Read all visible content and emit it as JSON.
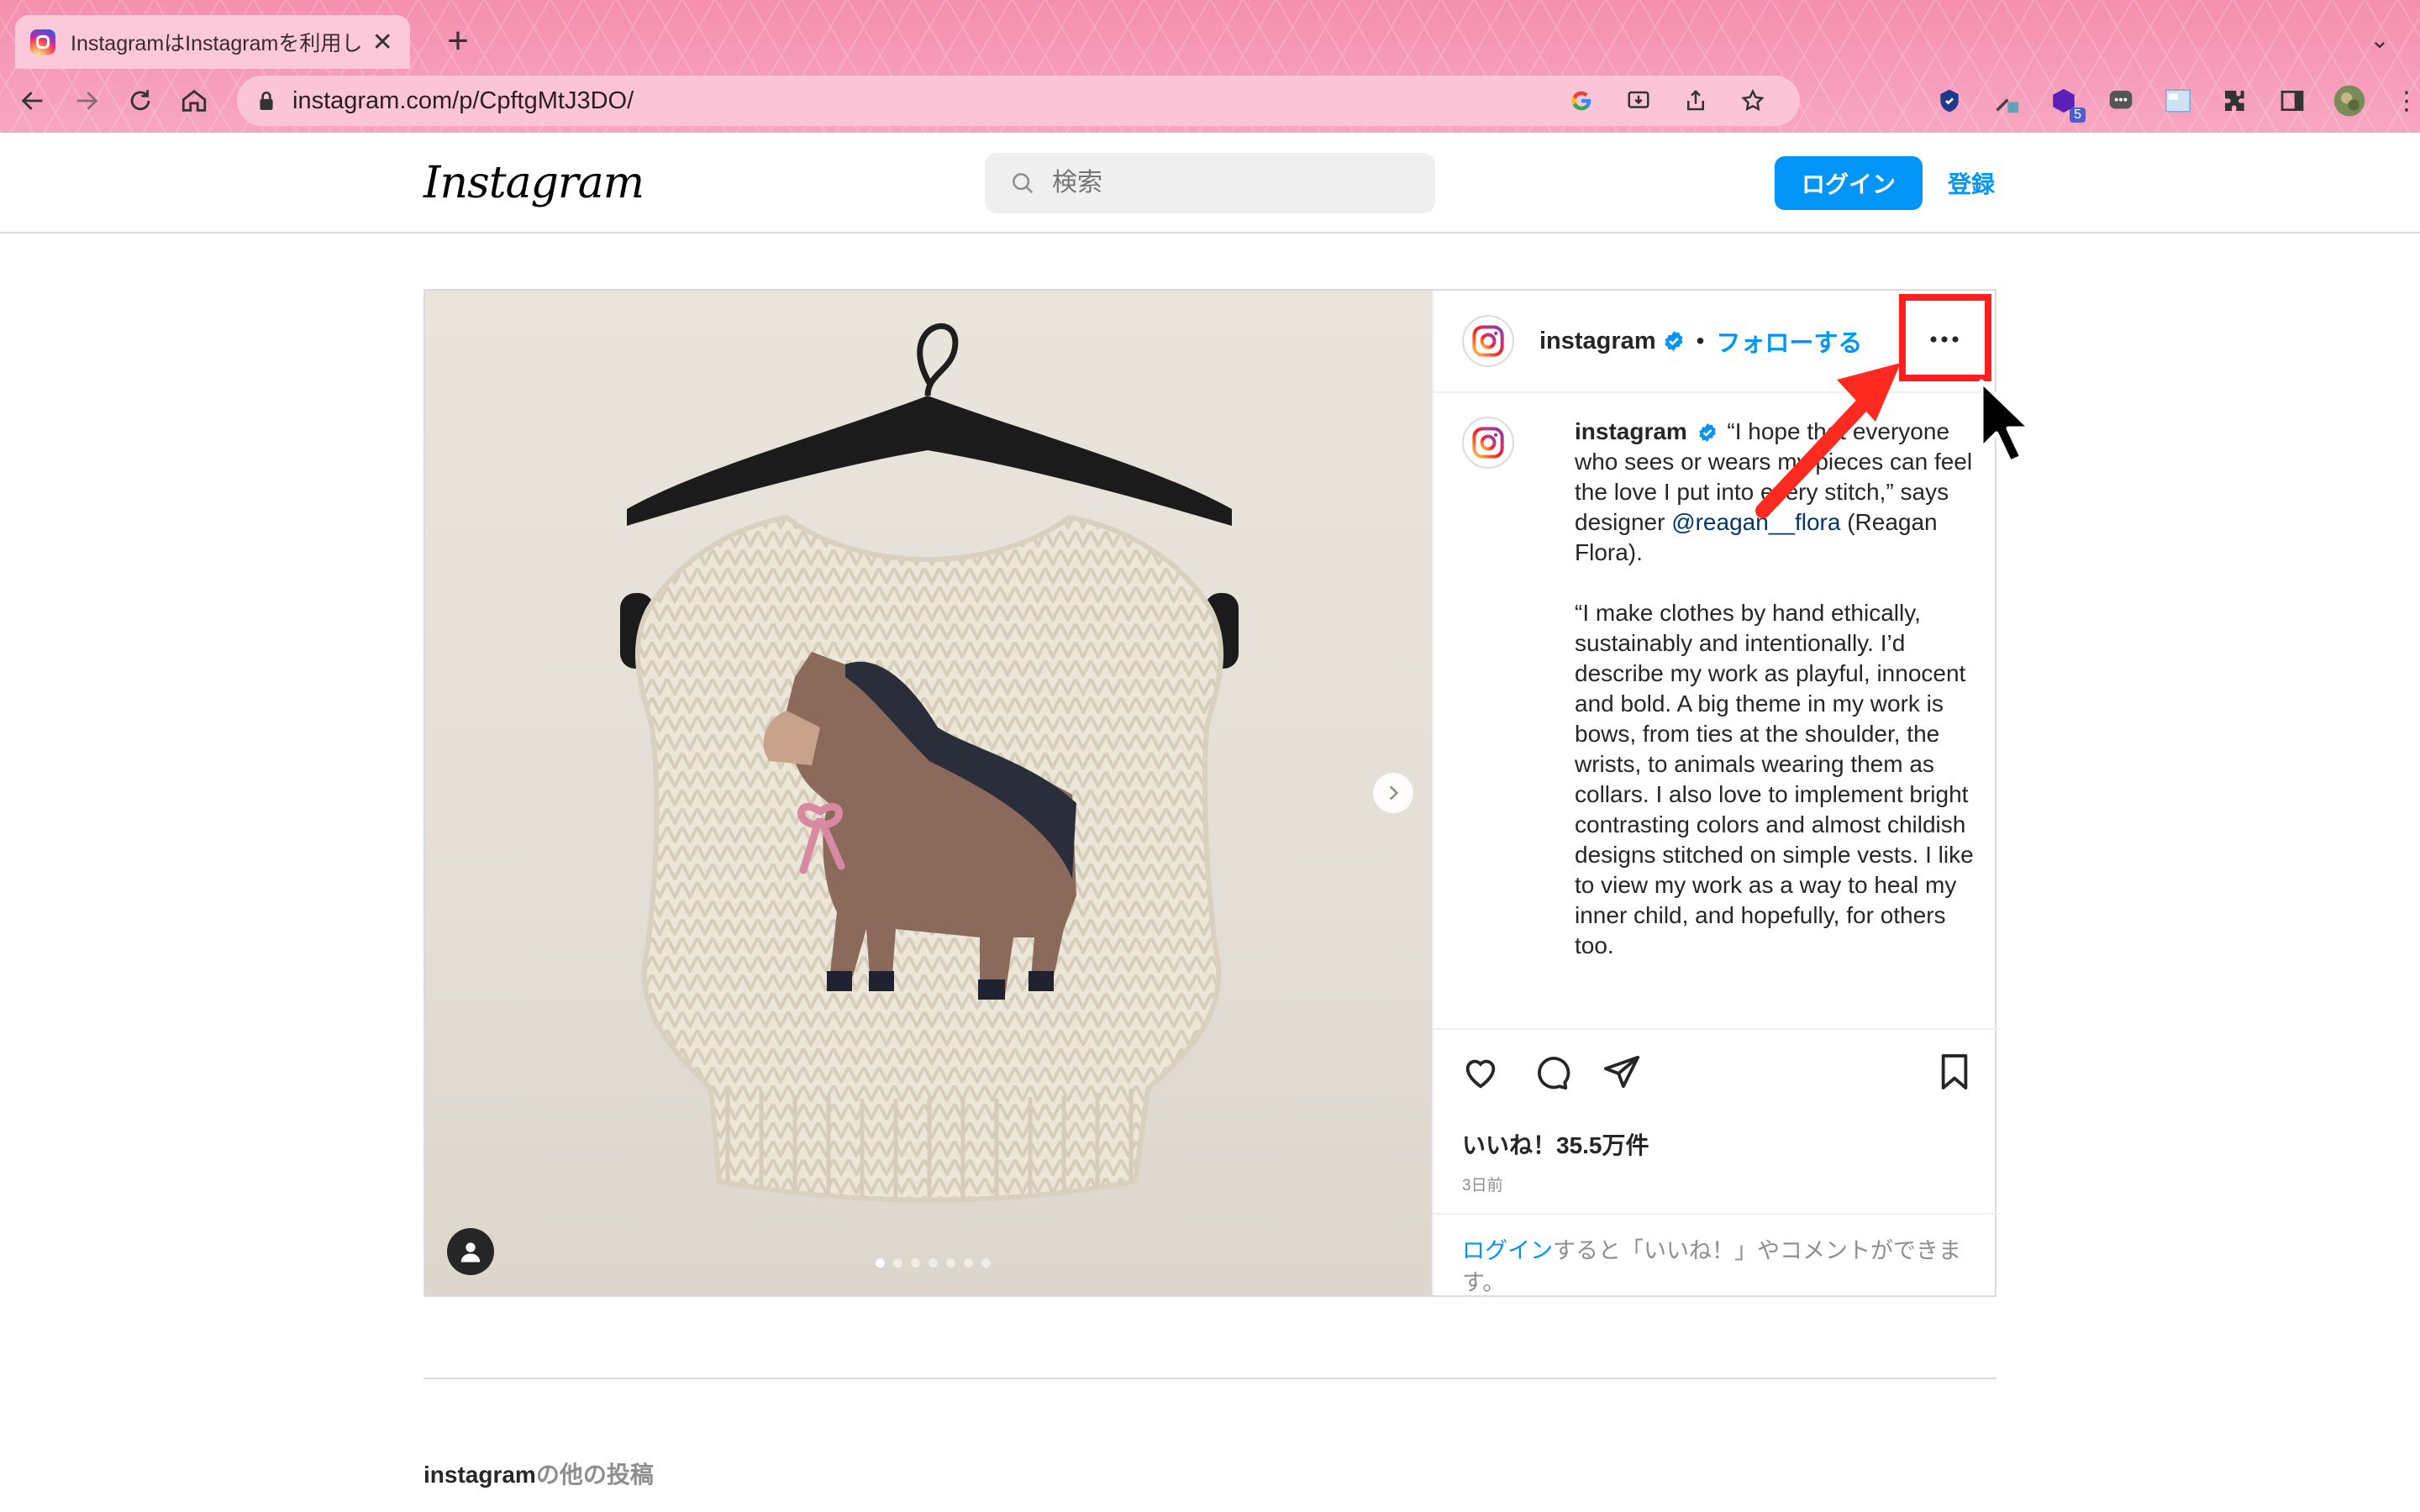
{
  "browser": {
    "tab_title": "InstagramはInstagramを利用し",
    "url": "instagram.com/p/CpftgMtJ3DO/",
    "extension_badge": "5"
  },
  "header": {
    "logo": "Instagram",
    "search_placeholder": "検索",
    "login_label": "ログイン",
    "signup_label": "登録"
  },
  "post": {
    "username": "instagram",
    "separator": "•",
    "follow_label": "フォローする",
    "more_label": "…",
    "caption": {
      "username": "instagram",
      "paragraph1_before": "“I hope that everyone who sees or wears my pieces can feel the love I put into every stitch,” says designer ",
      "mention": "@reagan__flora",
      "paragraph1_after": " (Reagan Flora).",
      "paragraph2": "“I make clothes by hand ethically, sustainably and intentionally. I’d describe my work as playful, innocent and bold. A big theme in my work is bows, from ties at the shoulder, the wrists, to animals wearing them as collars. I also love to implement bright contrasting colors and almost childish designs stitched on simple vests. I like to view my work as a way to heal my inner child, and hopefully, for others too."
    },
    "likes": "いいね！35.5万件",
    "time": "3日前",
    "login_prompt_link": "ログイン",
    "login_prompt_text": "すると「いいね！」やコメントができます。",
    "carousel_count": 7,
    "carousel_active": 0
  },
  "more_posts": {
    "username": "instagram",
    "suffix": "の他の投稿"
  },
  "colors": {
    "accent": "#0095f6",
    "annotation": "#ff1f1f",
    "chrome": "#f7a6c2"
  }
}
